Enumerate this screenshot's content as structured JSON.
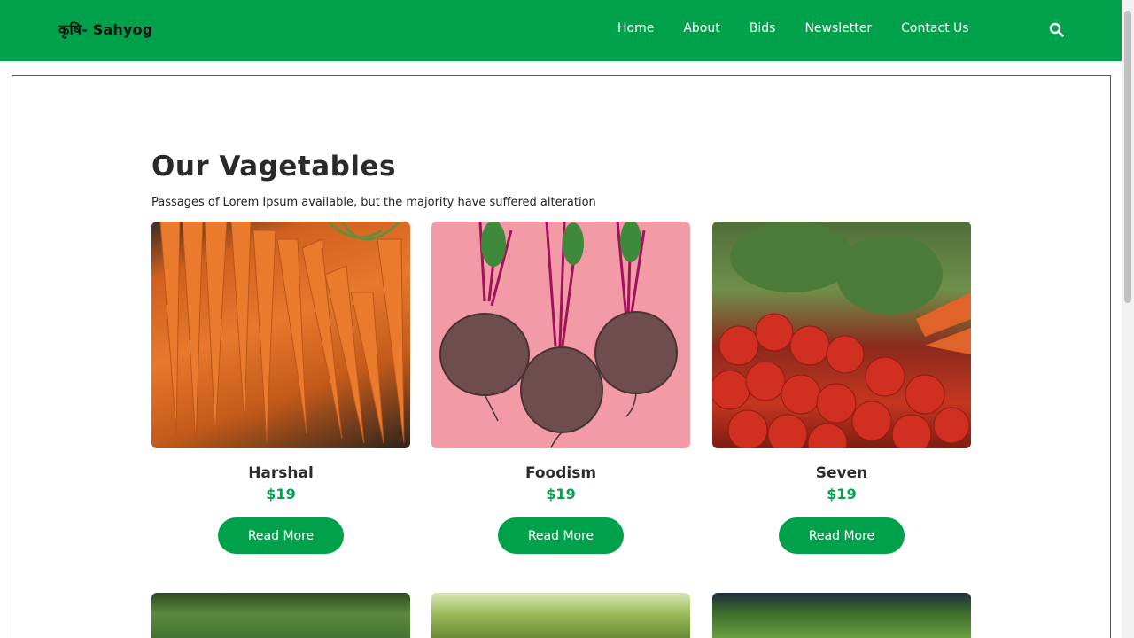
{
  "brand": "कृषि- Sahyog",
  "nav": [
    "Home",
    "About",
    "Bids",
    "Newsletter",
    "Contact Us"
  ],
  "section": {
    "title": "Our Vagetables",
    "subtitle": "Passages of Lorem Ipsum available, but the majority have suffered alteration"
  },
  "products": [
    {
      "name": "Harshal",
      "price": "$19",
      "button": "Read More",
      "image": "carrots"
    },
    {
      "name": "Foodism",
      "price": "$19",
      "button": "Read More",
      "image": "beetroots"
    },
    {
      "name": "Seven",
      "price": "$19",
      "button": "Read More",
      "image": "tomatoes"
    }
  ],
  "colors": {
    "primary": "#00a14b",
    "text": "#2a2a2a"
  }
}
